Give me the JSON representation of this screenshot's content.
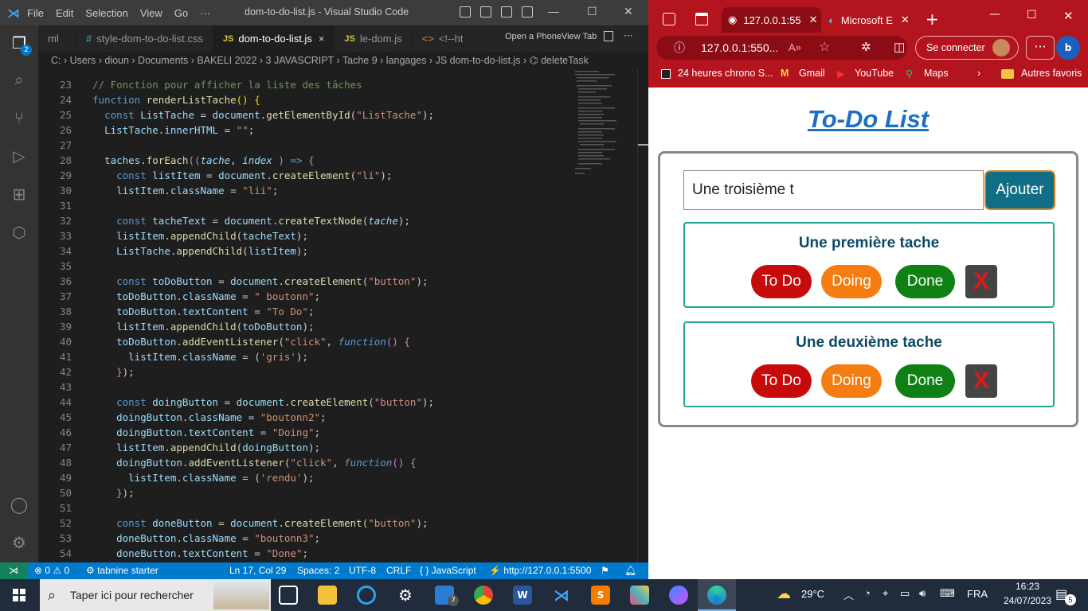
{
  "vscode": {
    "logo": "⋊",
    "menu": [
      "File",
      "Edit",
      "Selection",
      "View",
      "Go",
      "···"
    ],
    "title": "dom-to-do-list.js - Visual Studio Code",
    "tabs": [
      {
        "icon": "",
        "label": "ml",
        "active": false
      },
      {
        "icon": "#",
        "label": "style-dom-to-do-list.css",
        "active": false
      },
      {
        "icon": "JS",
        "label": "dom-to-do-list.js",
        "active": true
      },
      {
        "icon": "JS",
        "label": "le-dom.js",
        "active": false
      },
      {
        "icon": "<>",
        "label": "<!--ht",
        "active": false
      }
    ],
    "tab_close": "×",
    "phoneview": "Open a PhoneView Tab",
    "more": "···",
    "breadcrumb": "C: › Users › dioun › Documents › BAKELI 2022 › 3 JAVASCRIPT › Tache 9 › langages › JS dom-to-do-list.js › ⌬ deleteTask",
    "activity_badge": "2",
    "lines": [
      {
        "n": "23",
        "html": "<span class='c'>// Fonction pour afficher la liste des tâches</span>"
      },
      {
        "n": "24",
        "html": "<span class='k'>function</span> <span class='f'>renderListTache</span><span class='p'>()</span> <span class='p'>{</span>"
      },
      {
        "n": "25",
        "html": "  <span class='k'>const</span> <span class='v'>ListTache</span> = <span class='v'>document</span>.<span class='f'>getElementById</span>(<span class='s'>\"ListTache\"</span>);"
      },
      {
        "n": "26",
        "html": "  <span class='v'>ListTache</span>.<span class='v'>innerHTML</span> = <span class='s'>\"\"</span>;"
      },
      {
        "n": "27",
        "html": ""
      },
      {
        "n": "28",
        "html": "  <span class='v'>taches</span>.<span class='f'>forEach</span><span class='fn'>((</span><span class='it'>tache</span>, <span class='it'>index</span> <span class='fn'>)</span> <span class='k'>=></span> <span class='fn'>{</span>"
      },
      {
        "n": "29",
        "html": "    <span class='k'>const</span> <span class='v'>listItem</span> = <span class='v'>document</span>.<span class='f'>createElement</span>(<span class='s'>\"li\"</span>);"
      },
      {
        "n": "30",
        "html": "    <span class='v'>listItem</span>.<span class='v'>className</span> = <span class='s'>\"lii\"</span>;"
      },
      {
        "n": "31",
        "html": ""
      },
      {
        "n": "32",
        "html": "    <span class='k'>const</span> <span class='v'>tacheText</span> = <span class='v'>document</span>.<span class='f'>createTextNode</span>(<span class='it'>tache</span>);"
      },
      {
        "n": "33",
        "html": "    <span class='v'>listItem</span>.<span class='f'>appendChild</span>(<span class='v'>tacheText</span>);"
      },
      {
        "n": "34",
        "html": "    <span class='v'>ListTache</span>.<span class='f'>appendChild</span>(<span class='v'>listItem</span>);"
      },
      {
        "n": "35",
        "html": ""
      },
      {
        "n": "36",
        "html": "    <span class='k'>const</span> <span class='v'>toDoButton</span> = <span class='v'>document</span>.<span class='f'>createElement</span>(<span class='s'>\"button\"</span>);"
      },
      {
        "n": "37",
        "html": "    <span class='v'>toDoButton</span>.<span class='v'>className</span> = <span class='s'>\" boutonn\"</span>;"
      },
      {
        "n": "38",
        "html": "    <span class='v'>toDoButton</span>.<span class='v'>textContent</span> = <span class='s'>\"To Do\"</span>;"
      },
      {
        "n": "39",
        "html": "    <span class='v'>listItem</span>.<span class='f'>appendChild</span>(<span class='v'>toDoButton</span>);"
      },
      {
        "n": "40",
        "html": "    <span class='v'>toDoButton</span>.<span class='f'>addEventListener</span>(<span class='s'>\"click\"</span>, <span class='k' style='font-style:italic'>function</span><span class='fn'>()</span> <span class='fn'>{</span>"
      },
      {
        "n": "41",
        "html": "      <span class='v'>listItem</span>.<span class='v'>className</span> = (<span class='s'>'gris'</span>);"
      },
      {
        "n": "42",
        "html": "    <span class='fn'>}</span>);"
      },
      {
        "n": "43",
        "html": ""
      },
      {
        "n": "44",
        "html": "    <span class='k'>const</span> <span class='v'>doingButton</span> = <span class='v'>document</span>.<span class='f'>createElement</span>(<span class='s'>\"button\"</span>);"
      },
      {
        "n": "45",
        "html": "    <span class='v'>doingButton</span>.<span class='v'>className</span> = <span class='s'>\"boutonn2\"</span>;"
      },
      {
        "n": "46",
        "html": "    <span class='v'>doingButton</span>.<span class='v'>textContent</span> = <span class='s'>\"Doing\"</span>;"
      },
      {
        "n": "47",
        "html": "    <span class='v'>listItem</span>.<span class='f'>appendChild</span>(<span class='v'>doingButton</span>);"
      },
      {
        "n": "48",
        "html": "    <span class='v'>doingButton</span>.<span class='f'>addEventListener</span>(<span class='s'>\"click\"</span>, <span class='k' style='font-style:italic'>function</span><span class='fn'>()</span> <span class='fn'>{</span>"
      },
      {
        "n": "49",
        "html": "      <span class='v'>listItem</span>.<span class='v'>className</span> = (<span class='s'>'rendu'</span>);"
      },
      {
        "n": "50",
        "html": "    <span class='fn'>}</span>);"
      },
      {
        "n": "51",
        "html": ""
      },
      {
        "n": "52",
        "html": "    <span class='k'>const</span> <span class='v'>doneButton</span> = <span class='v'>document</span>.<span class='f'>createElement</span>(<span class='s'>\"button\"</span>);"
      },
      {
        "n": "53",
        "html": "    <span class='v'>doneButton</span>.<span class='v'>className</span> = <span class='s'>\"boutonn3\"</span>;"
      },
      {
        "n": "54",
        "html": "    <span class='v'>doneButton</span>.<span class='v'>textContent</span> = <span class='s'>\"Done\"</span>;"
      }
    ],
    "status": {
      "remote": "⋊",
      "problems": "⊗ 0 ⚠ 0",
      "tabnine": "⚙ tabnine starter",
      "position": "Ln 17, Col 29",
      "spaces": "Spaces: 2",
      "encoding": "UTF-8",
      "eol": "CRLF",
      "language": "{ } JavaScript",
      "server": "⚡ http://127.0.0.1:5500"
    }
  },
  "edge": {
    "tab_active": "127.0.0.1:55",
    "tab_other": "Microsoft E",
    "new_tab": "+",
    "address": "127.0.0.1:550...",
    "read_aloud": "A»",
    "signin": "Se connecter",
    "more": "···",
    "favorites": [
      "24 heures chrono S...",
      "Gmail",
      "YouTube",
      "Maps"
    ],
    "fav_chevron": "›",
    "other_favorites": "Autres favoris",
    "page": {
      "title": "To-Do List",
      "input_value": "Une troisième t",
      "add_label": "Ajouter",
      "tasks": [
        {
          "name": "Une première tache",
          "todo": "To Do",
          "doing": "Doing",
          "done": "Done",
          "delete": "X"
        },
        {
          "name": "Une deuxième tache",
          "todo": "To Do",
          "doing": "Doing",
          "done": "Done",
          "delete": "X"
        }
      ]
    },
    "colors": {
      "brand": "#b4141e",
      "todo": "#c70b0b",
      "doing": "#f57c10",
      "done": "#0e8014",
      "title": "#1c6fc4"
    }
  },
  "taskbar": {
    "search_placeholder": "Taper ici pour rechercher",
    "mail_badge": "7",
    "weather": "29°C",
    "lang": "FRA",
    "time": "16:23",
    "date": "24/07/2023",
    "notif_count": "5"
  }
}
